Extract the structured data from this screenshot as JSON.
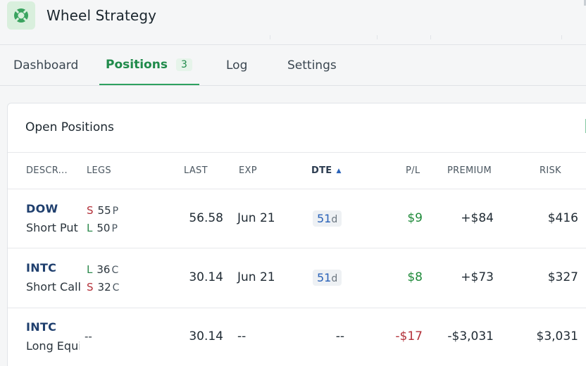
{
  "app": {
    "title": "Wheel Strategy"
  },
  "tabs": [
    {
      "label": "Dashboard"
    },
    {
      "label": "Positions",
      "count": "3"
    },
    {
      "label": "Log"
    },
    {
      "label": "Settings"
    }
  ],
  "card": {
    "title": "Open Positions"
  },
  "columns": {
    "description": "DESCR...",
    "legs": "LEGS",
    "last": "LAST",
    "exp": "EXP",
    "dte": "DTE",
    "pl": "P/L",
    "premium": "PREMIUM",
    "risk": "RISK"
  },
  "rows": [
    {
      "symbol": "DOW",
      "description": "Short Put",
      "legs": [
        {
          "side": "S",
          "strike": "55",
          "type": "P"
        },
        {
          "side": "L",
          "strike": "50",
          "type": "P"
        }
      ],
      "last": "56.58",
      "exp": "Jun 21",
      "dte_value": "51",
      "dte_unit": "d",
      "pl": "$9",
      "premium": "+$84",
      "risk": "$416"
    },
    {
      "symbol": "INTC",
      "description": "Short Call",
      "legs": [
        {
          "side": "L",
          "strike": "36",
          "type": "C"
        },
        {
          "side": "S",
          "strike": "32",
          "type": "C"
        }
      ],
      "last": "30.14",
      "exp": "Jun 21",
      "dte_value": "51",
      "dte_unit": "d",
      "pl": "$8",
      "premium": "+$73",
      "risk": "$327"
    },
    {
      "symbol": "INTC",
      "description": "Long Equi",
      "legs_text": "--",
      "last": "30.14",
      "exp": "--",
      "dte_text": "--",
      "pl": "-$17",
      "premium": "-$3,031",
      "risk": "$3,031"
    }
  ],
  "colors": {
    "accent": "#1f8a4a",
    "positive": "#1f8a3a",
    "negative": "#b3313a",
    "link": "#2a62b8"
  },
  "icons": {
    "logo": "lifebuoy-icon",
    "sort": "sort-ascending-icon"
  }
}
